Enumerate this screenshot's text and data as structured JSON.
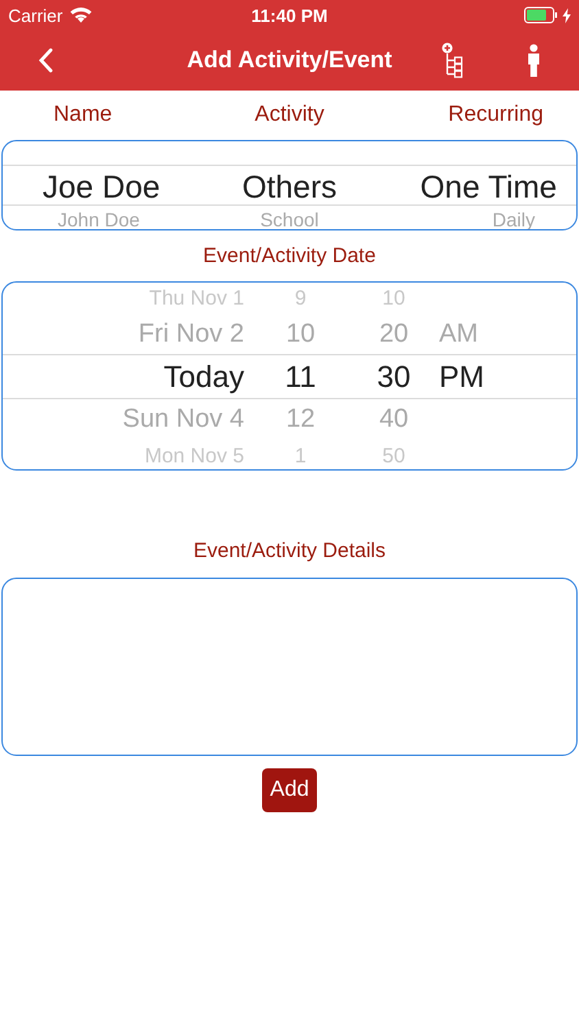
{
  "status_bar": {
    "carrier": "Carrier",
    "time": "11:40 PM"
  },
  "nav_bar": {
    "title": "Add Activity/Event"
  },
  "selection_headers": [
    "Name",
    "Activity",
    "Recurring"
  ],
  "selection_picker": {
    "rows": [
      {
        "cells": [
          "Joe Doe",
          "Others",
          "One Time"
        ],
        "selected": true
      },
      {
        "cells": [
          "John Doe",
          "School",
          "Daily"
        ],
        "selected": false
      }
    ]
  },
  "date_title": "Event/Activity Date",
  "date_picker": {
    "rows": [
      {
        "cells": [
          "Thu Nov 1",
          "9",
          "10"
        ],
        "selected": false
      },
      {
        "cells": [
          "Fri Nov 2",
          "10",
          "20",
          "AM"
        ],
        "selected": false
      },
      {
        "cells": [
          "Today",
          "11",
          "30",
          "PM"
        ],
        "selected": true
      },
      {
        "cells": [
          "Sun Nov 4",
          "12",
          "40"
        ],
        "selected": false
      },
      {
        "cells": [
          "Mon Nov 5",
          "1",
          "50"
        ],
        "selected": false
      }
    ]
  },
  "details_title": "Event/Activity Details",
  "add_button": "Add"
}
